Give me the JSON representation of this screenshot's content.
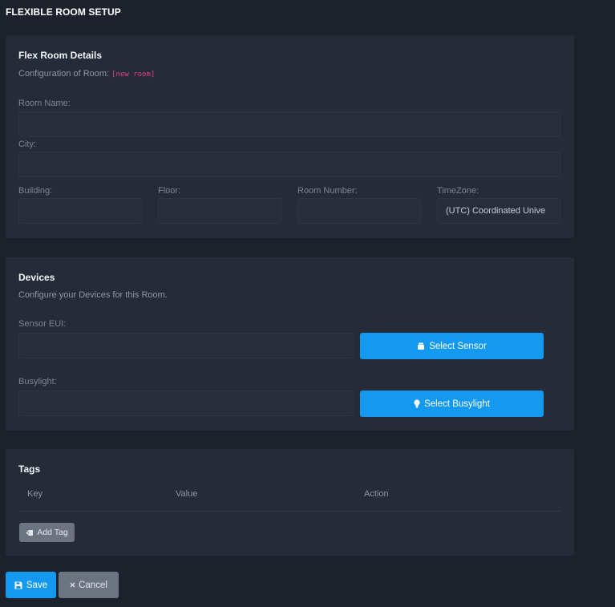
{
  "page": {
    "title": "FLEXIBLE ROOM SETUP"
  },
  "details": {
    "title": "Flex Room Details",
    "subtitle": "Configuration of Room:",
    "room_tag": "[new room]",
    "room_name_label": "Room Name:",
    "room_name_value": "",
    "city_label": "City:",
    "city_value": "",
    "building_label": "Building:",
    "building_value": "",
    "floor_label": "Floor:",
    "floor_value": "",
    "room_number_label": "Room Number:",
    "room_number_value": "",
    "timezone_label": "TimeZone:",
    "timezone_value": "(UTC) Coordinated Unive"
  },
  "devices": {
    "title": "Devices",
    "subtitle": "Configure your Devices for this Room.",
    "sensor_label": "Sensor EUI:",
    "sensor_value": "",
    "select_sensor_label": "Select Sensor",
    "busylight_label": "Busylight:",
    "busylight_value": "",
    "select_busylight_label": "Select Busylight"
  },
  "tags": {
    "title": "Tags",
    "columns": [
      "Key",
      "Value",
      "Action"
    ],
    "add_tag_label": "Add Tag"
  },
  "footer": {
    "save_label": "Save",
    "cancel_label": "Cancel"
  },
  "icons": {
    "sensor": "sensor-icon",
    "busylight": "lightbulb-icon",
    "tag": "tag-icon",
    "save": "floppy-disk-icon",
    "cancel": "close-icon"
  },
  "colors": {
    "accent": "#1499f0",
    "secondary": "#6c7381",
    "code": "#e83e8c"
  }
}
